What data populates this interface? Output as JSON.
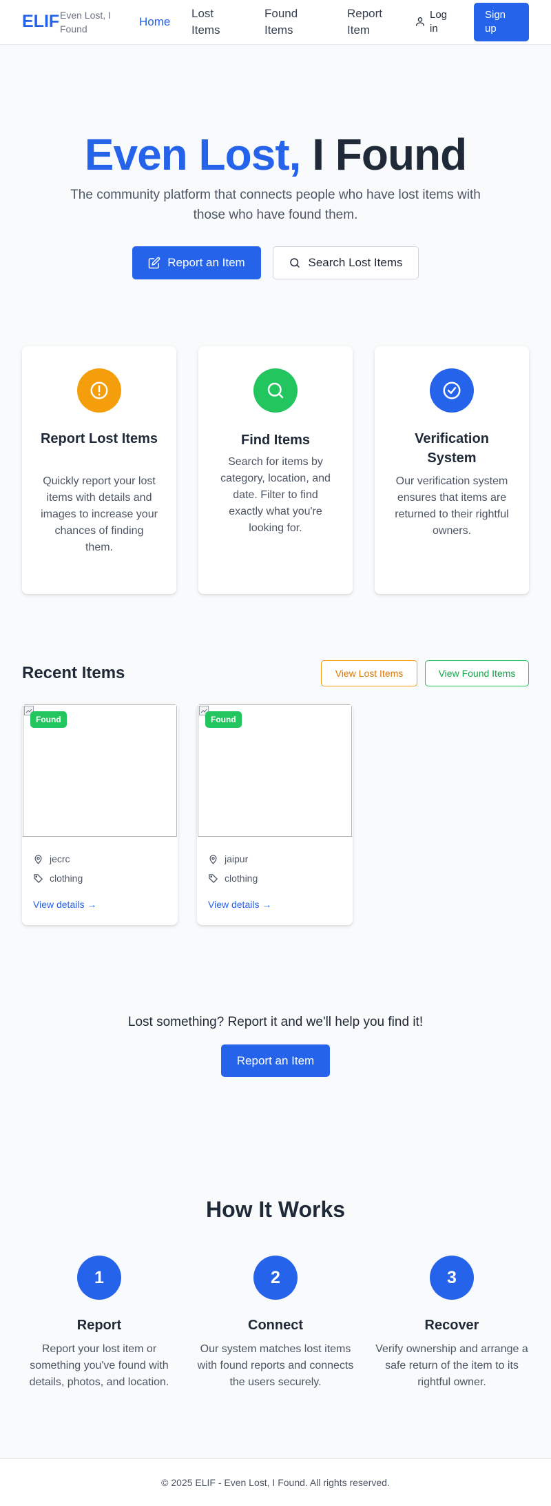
{
  "nav": {
    "logo": "ELIF",
    "tagline": "Even Lost, I Found",
    "links": [
      {
        "label": "Home",
        "active": true
      },
      {
        "label": "Lost Items",
        "active": false
      },
      {
        "label": "Found Items",
        "active": false
      },
      {
        "label": "Report Item",
        "active": false
      }
    ],
    "login_label": "Log in",
    "signup_label": "Sign up"
  },
  "hero": {
    "title_part1": "Even Lost,",
    "title_part2": "I Found",
    "subtitle": "The community platform that connects people who have lost items with those who have found them.",
    "primary_button": "Report an Item",
    "secondary_button": "Search Lost Items"
  },
  "features": [
    {
      "title": "Report Lost Items",
      "description": "Quickly report your lost items with details and images to increase your chances of finding them.",
      "icon": "alert-circle-icon",
      "color": "#f59e0b"
    },
    {
      "title": "Find Items",
      "description": "Search for items by category, location, and date. Filter to find exactly what you're looking for.",
      "icon": "search-icon",
      "color": "#22c55e"
    },
    {
      "title": "Verification System",
      "description": "Our verification system ensures that items are returned to their rightful owners.",
      "icon": "check-circle-icon",
      "color": "#2563eb"
    }
  ],
  "recent": {
    "title": "Recent Items",
    "view_lost_label": "View Lost Items",
    "view_found_label": "View Found Items",
    "items": [
      {
        "status": "Found",
        "location": "jecrc",
        "category": "clothing",
        "link": "View details →"
      },
      {
        "status": "Found",
        "location": "jaipur",
        "category": "clothing",
        "link": "View details →"
      }
    ]
  },
  "cta": {
    "text": "Lost something? Report it and we'll help you find it!",
    "button": "Report an Item"
  },
  "how": {
    "title": "How It Works",
    "steps": [
      {
        "number": "1",
        "title": "Report",
        "description": "Report your lost item or something you've found with details, photos, and location."
      },
      {
        "number": "2",
        "title": "Connect",
        "description": "Our system matches lost items with found reports and connects the users securely."
      },
      {
        "number": "3",
        "title": "Recover",
        "description": "Verify ownership and arrange a safe return of the item to its rightful owner."
      }
    ]
  },
  "footer": {
    "text": "© 2025 ELIF - Even Lost, I Found. All rights reserved."
  },
  "colors": {
    "primary": "#2563eb",
    "amber": "#f59e0b",
    "green": "#22c55e",
    "background": "#f9fafb"
  }
}
